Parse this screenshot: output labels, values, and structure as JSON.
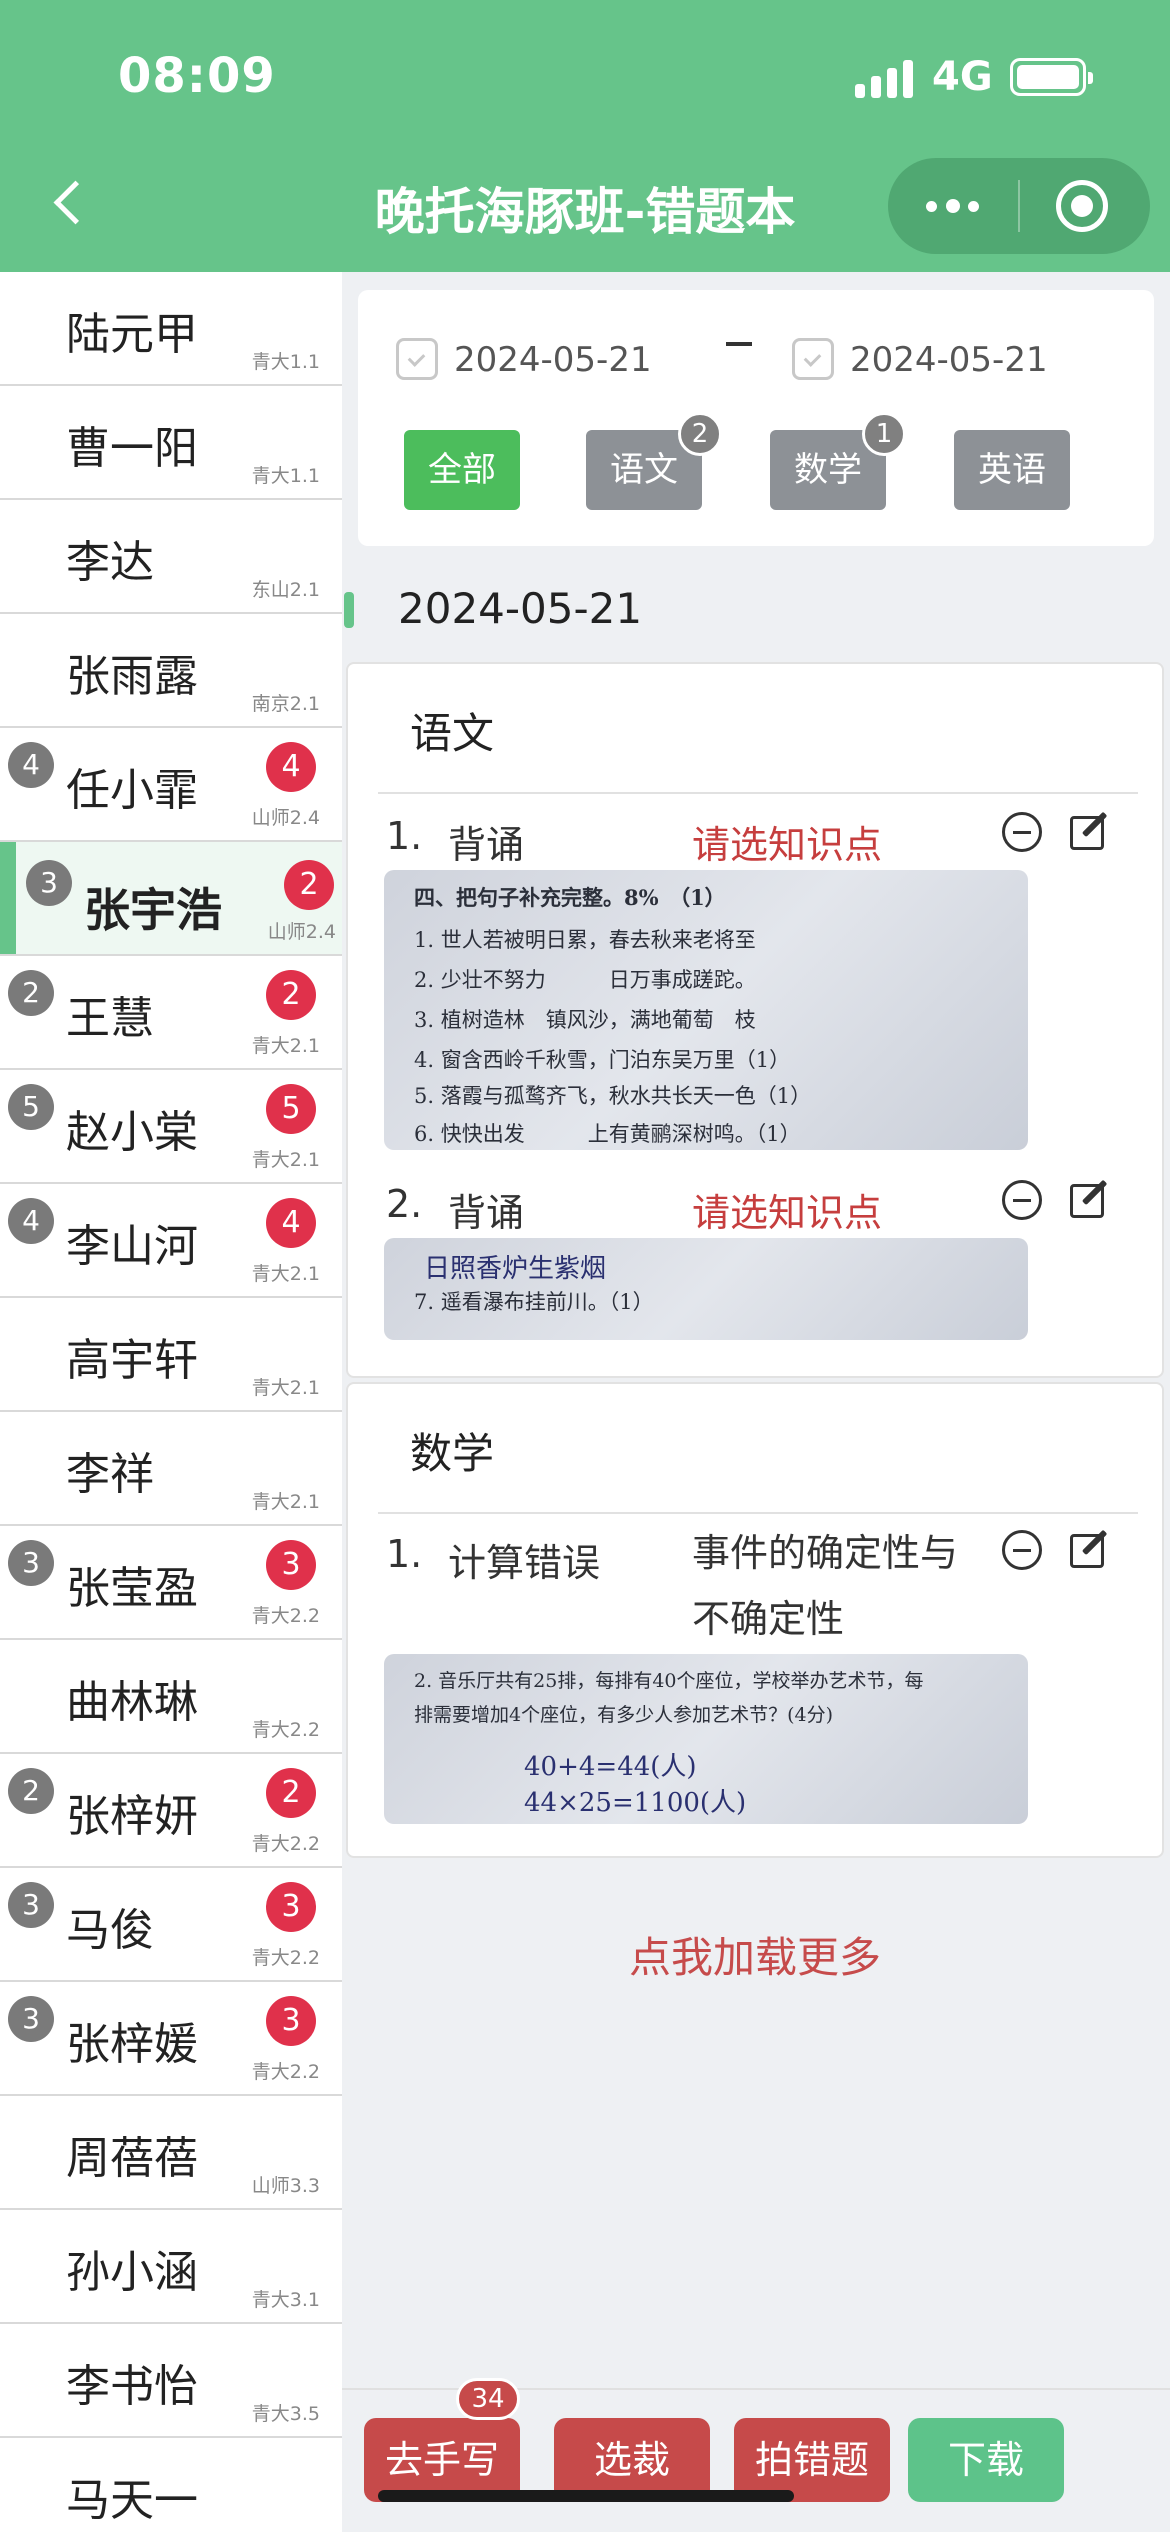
{
  "status": {
    "time": "08:09",
    "network": "4G"
  },
  "header": {
    "title": "晚托海豚班-错题本"
  },
  "students": [
    {
      "name": "陆元甲",
      "cls": "青大1.1"
    },
    {
      "name": "曹一阳",
      "cls": "青大1.1"
    },
    {
      "name": "李达",
      "cls": "东山2.1"
    },
    {
      "name": "张雨露",
      "cls": "南京2.1"
    },
    {
      "name": "任小霏",
      "cls": "山师2.4",
      "gray": "4",
      "red": "4"
    },
    {
      "name": "张宇浩",
      "cls": "山师2.4",
      "gray": "3",
      "red": "2"
    },
    {
      "name": "王慧",
      "cls": "青大2.1",
      "gray": "2",
      "red": "2"
    },
    {
      "name": "赵小棠",
      "cls": "青大2.1",
      "gray": "5",
      "red": "5"
    },
    {
      "name": "李山河",
      "cls": "青大2.1",
      "gray": "4",
      "red": "4"
    },
    {
      "name": "高宇轩",
      "cls": "青大2.1"
    },
    {
      "name": "李祥",
      "cls": "青大2.1"
    },
    {
      "name": "张莹盈",
      "cls": "青大2.2",
      "gray": "3",
      "red": "3"
    },
    {
      "name": "曲林琳",
      "cls": "青大2.2"
    },
    {
      "name": "张梓妍",
      "cls": "青大2.2",
      "gray": "2",
      "red": "2"
    },
    {
      "name": "马俊",
      "cls": "青大2.2",
      "gray": "3",
      "red": "3"
    },
    {
      "name": "张梓媛",
      "cls": "青大2.2",
      "gray": "3",
      "red": "3"
    },
    {
      "name": "周蓓蓓",
      "cls": "山师3.3"
    },
    {
      "name": "孙小涵",
      "cls": "青大3.1"
    },
    {
      "name": "李书怡",
      "cls": "青大3.5"
    },
    {
      "name": "马天一",
      "cls": ""
    }
  ],
  "filter": {
    "start_date": "2024-05-21",
    "end_date": "2024-05-21",
    "subjects": [
      {
        "label": "全部",
        "count": ""
      },
      {
        "label": "语文",
        "count": "2"
      },
      {
        "label": "数学",
        "count": "1"
      },
      {
        "label": "英语",
        "count": ""
      }
    ]
  },
  "list": {
    "date": "2024-05-21",
    "chinese": {
      "title": "语文",
      "q1": {
        "num": "1.",
        "type": "背诵",
        "kp": "请选知识点"
      },
      "q2": {
        "num": "2.",
        "type": "背诵",
        "kp": "请选知识点"
      },
      "img1_lines": [
        "四、把句子补充完整。8%　（1）",
        "1. 世人若被明日累，春去秋来老将至",
        "2. 少壮不努力　　　日万事成蹉跎。",
        "3. 植树造林　镇风沙，满地葡萄　枝",
        "4. 窗含西岭千秋雪，门泊东吴万里（1）",
        "5. 落霞与孤鹜齐飞，秋水共长天一色（1）",
        "6. 快快出发　　　上有黄鹂深树鸣。（1）"
      ],
      "img2_lines": [
        "日照香炉生紫烟",
        "7. 遥看瀑布挂前川。（1）"
      ]
    },
    "math": {
      "title": "数学",
      "q1": {
        "num": "1.",
        "type": "计算错误",
        "kp": "事件的确定性与不确定性"
      },
      "img_lines": [
        "2. 音乐厅共有25排，每排有40个座位，学校举办艺术节，每",
        "排需要增加4个座位，有多少人参加艺术节？(4分)",
        "40+4=44(人)",
        "44×25=1100(人)"
      ]
    },
    "load_more": "点我加载更多"
  },
  "actions": {
    "handwrite": "去手写",
    "handwrite_count": "34",
    "select": "选裁",
    "photo": "拍错题",
    "download": "下载"
  }
}
